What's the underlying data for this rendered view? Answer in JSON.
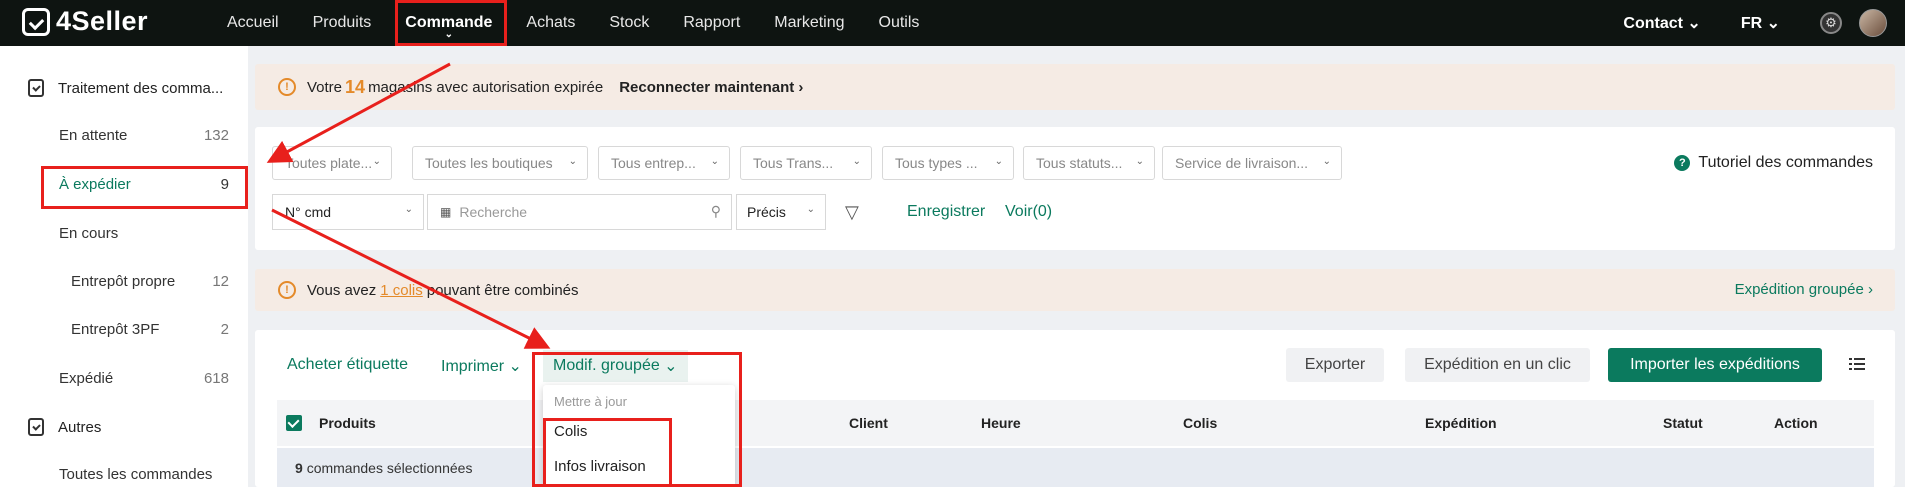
{
  "brand": "4Seller",
  "nav": [
    "Accueil",
    "Produits",
    "Commande",
    "Achats",
    "Stock",
    "Rapport",
    "Marketing",
    "Outils"
  ],
  "right_nav": {
    "contact": "Contact",
    "lang": "FR"
  },
  "sidebar": {
    "group1": "Traitement des comma...",
    "items": [
      {
        "label": "En attente",
        "count": "132"
      },
      {
        "label": "À expédier",
        "count": "9"
      },
      {
        "label": "En cours",
        "count": ""
      },
      {
        "label": "Entrepôt propre",
        "count": "12"
      },
      {
        "label": "Entrepôt 3PF",
        "count": "2"
      },
      {
        "label": "Expédié",
        "count": "618"
      }
    ],
    "group2": "Autres",
    "all_orders": "Toutes les commandes"
  },
  "alert1": {
    "prefix": "Votre",
    "num": "14",
    "suffix": "magasins avec autorisation expirée",
    "action": "Reconnecter maintenant ›"
  },
  "filters": {
    "selects": [
      "Toutes plate...",
      "Toutes les boutiques",
      "Tous entrep...",
      "Tous Trans...",
      "Tous types ...",
      "Tous statuts...",
      "Service de livraison..."
    ],
    "tutorial": "Tutoriel des commandes",
    "search_type": "N° cmd",
    "search_placeholder": "Recherche",
    "precision": "Précis",
    "save": "Enregistrer",
    "view": "Voir(0)"
  },
  "alert2": {
    "prefix": "Vous avez",
    "link": "1 colis",
    "suffix": "pouvant être combinés",
    "action": "Expédition groupée ›"
  },
  "toolbar": {
    "buy_label": "Acheter étiquette",
    "print": "Imprimer",
    "bulk": "Modif. groupée",
    "export": "Exporter",
    "one_click": "Expédition en un clic",
    "import": "Importer les expéditions"
  },
  "table": {
    "columns": [
      "Produits",
      "Client",
      "Heure",
      "Colis",
      "Expédition",
      "Statut",
      "Action"
    ],
    "selected_count": "9",
    "selected_text": "commandes sélectionnées"
  },
  "dropdown": {
    "header": "Mettre à jour",
    "items": [
      "Colis",
      "Infos livraison"
    ]
  }
}
